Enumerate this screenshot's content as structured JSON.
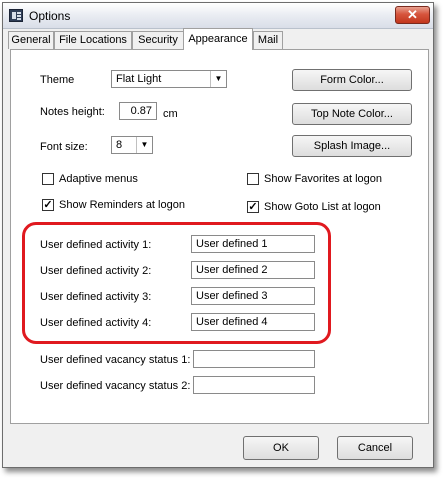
{
  "window": {
    "title": "Options"
  },
  "tabs": [
    {
      "label": "General"
    },
    {
      "label": "File Locations"
    },
    {
      "label": "Security"
    },
    {
      "label": "Appearance"
    },
    {
      "label": "Mail"
    }
  ],
  "appearance": {
    "theme_label": "Theme",
    "theme_value": "Flat Light",
    "notes_height_label": "Notes height:",
    "notes_height_value": "0.87",
    "notes_height_unit": "cm",
    "font_size_label": "Font size:",
    "font_size_value": "8",
    "form_color_button": "Form Color...",
    "top_note_color_button": "Top Note Color...",
    "splash_image_button": "Splash Image...",
    "checkboxes": [
      {
        "label": "Adaptive menus",
        "checked": false
      },
      {
        "label": "Show Favorites at logon",
        "checked": false
      },
      {
        "label": "Show Reminders at logon",
        "checked": true
      },
      {
        "label": "Show Goto List at logon",
        "checked": true
      }
    ],
    "activities": [
      {
        "label": "User defined activity 1:",
        "value": "User defined 1"
      },
      {
        "label": "User defined activity 2:",
        "value": "User defined 2"
      },
      {
        "label": "User defined activity 3:",
        "value": "User defined 3"
      },
      {
        "label": "User defined activity 4:",
        "value": "User defined 4"
      }
    ],
    "vacancy": [
      {
        "label": "User defined vacancy status 1:",
        "value": ""
      },
      {
        "label": "User defined vacancy status 2:",
        "value": ""
      }
    ]
  },
  "footer": {
    "ok_label": "OK",
    "cancel_label": "Cancel"
  },
  "colors": {
    "highlight": "#e0191f",
    "close_button": "#c2361d"
  },
  "icons": {
    "app": "app-window-icon",
    "close": "close-icon",
    "dropdown": "chevron-down-icon",
    "check": "checkmark-icon"
  }
}
